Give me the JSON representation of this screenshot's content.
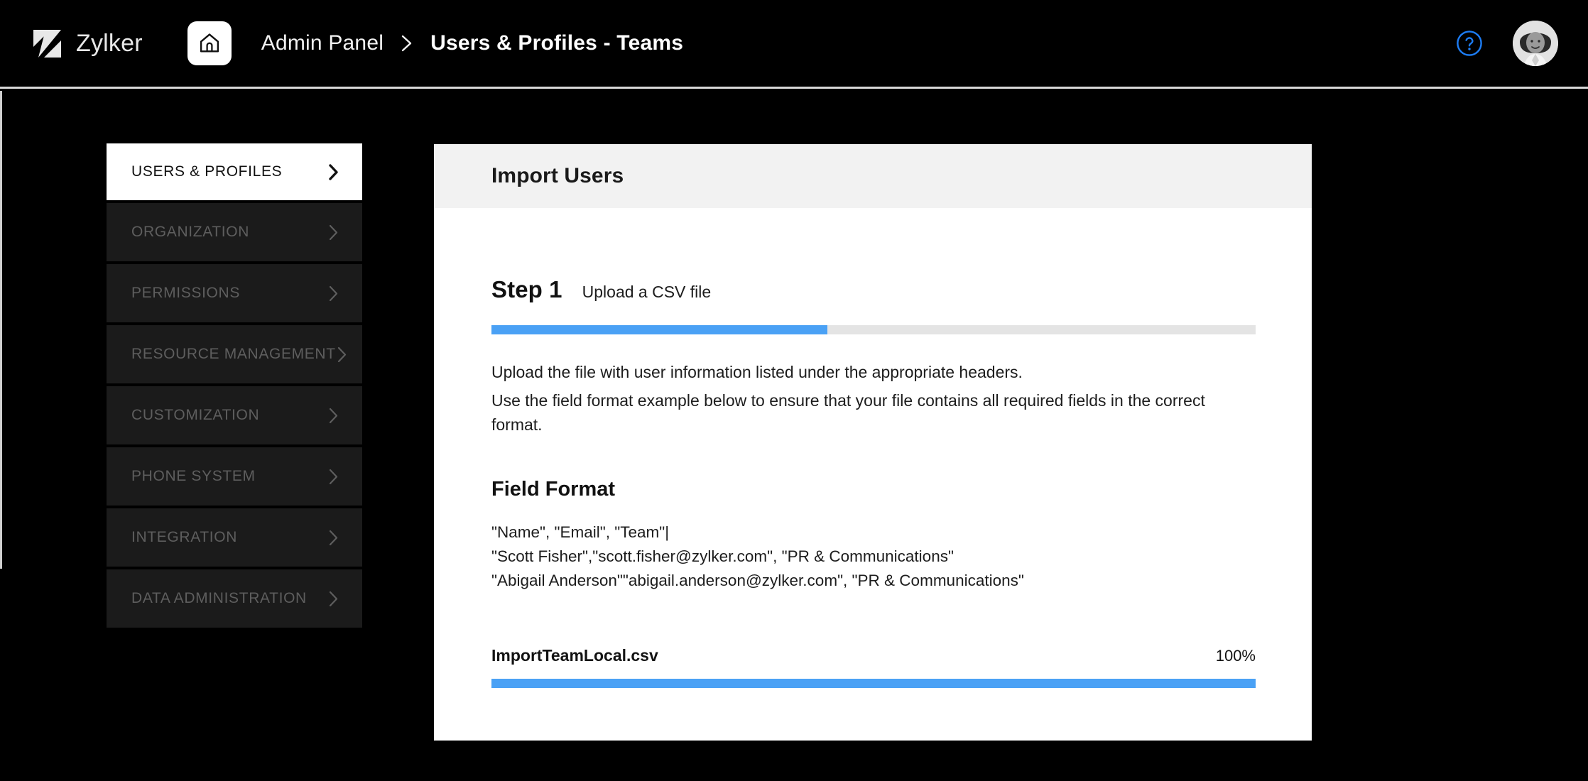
{
  "header": {
    "brand_name": "Zylker",
    "brand_logo_icon": "zylker-z-logo",
    "home_icon": "home-icon",
    "breadcrumb": {
      "root": "Admin Panel",
      "separator_icon": "chevron-right-icon",
      "current": "Users & Profiles - Teams"
    },
    "help_icon": "help-circle-icon",
    "avatar_icon": "user-avatar",
    "background_color": "#000000"
  },
  "sidebar": {
    "items": [
      {
        "label": "USERS & PROFILES",
        "active": true,
        "chevron_icon": "chevron-right-icon"
      },
      {
        "label": "ORGANIZATION",
        "active": false,
        "chevron_icon": "chevron-right-icon"
      },
      {
        "label": "PERMISSIONS",
        "active": false,
        "chevron_icon": "chevron-right-icon"
      },
      {
        "label": "RESOURCE MANAGEMENT",
        "active": false,
        "chevron_icon": "chevron-right-icon"
      },
      {
        "label": "CUSTOMIZATION",
        "active": false,
        "chevron_icon": "chevron-right-icon"
      },
      {
        "label": "PHONE SYSTEM",
        "active": false,
        "chevron_icon": "chevron-right-icon"
      },
      {
        "label": "INTEGRATION",
        "active": false,
        "chevron_icon": "chevron-right-icon"
      },
      {
        "label": "DATA ADMINISTRATION",
        "active": false,
        "chevron_icon": "chevron-right-icon"
      }
    ]
  },
  "panel": {
    "title": "Import Users",
    "step": {
      "label": "Step 1",
      "description": "Upload a CSV file",
      "progress_percent": 44
    },
    "instructions": [
      "Upload the file with user information listed under the appropriate headers.",
      "Use the field format example below to ensure that your file contains all required fields in the correct format."
    ],
    "field_format": {
      "title": "Field Format",
      "lines": [
        "\"Name\", \"Email\", \"Team\"|",
        "\"Scott Fisher\",\"scott.fisher@zylker.com\", \"PR & Communications\"",
        "\"Abigail Anderson\"\"abigail.anderson@zylker.com\", \"PR & Communications\""
      ]
    },
    "upload": {
      "file_name": "ImportTeamLocal.csv",
      "percent_label": "100%",
      "progress_percent": 100
    }
  },
  "colors": {
    "accent_blue": "#4aa1f5",
    "track_grey": "#e4e4e4",
    "panel_header_grey": "#f2f2f2",
    "nav_item_dark": "#1b1b1b",
    "nav_label_grey": "#5e5e5e",
    "background_black": "#000000"
  }
}
